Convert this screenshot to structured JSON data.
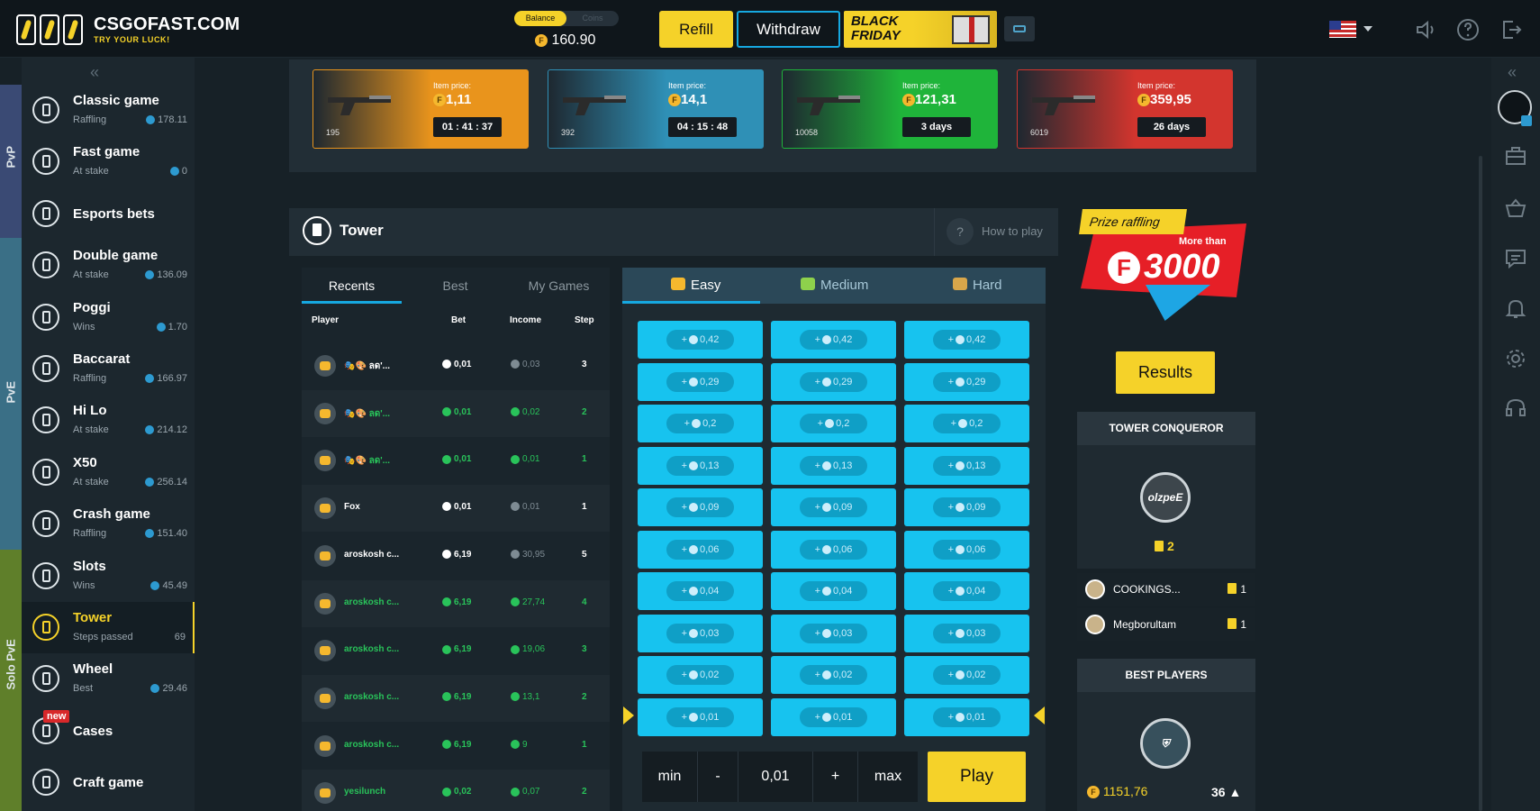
{
  "topbar": {
    "logo_title": "CSGOFAST.COM",
    "logo_subtitle": "TRY YOUR LUCK!",
    "balance_toggle_active": "Balance",
    "balance_toggle_inactive": "Coins",
    "balance_value": "160.90",
    "refill_label": "Refill",
    "withdraw_label": "Withdraw",
    "promo_line1": "BLACK",
    "promo_line2": "FRIDAY",
    "icons": [
      "flag-us-icon",
      "sound-icon",
      "help-icon",
      "logout-icon"
    ]
  },
  "side_tabs": [
    "PvP",
    "PvE",
    "Solo PvE"
  ],
  "sidebar": {
    "items": [
      {
        "name": "Classic game",
        "sub": "Raffling",
        "value": "178.11"
      },
      {
        "name": "Fast game",
        "sub": "At stake",
        "value": "0"
      },
      {
        "name": "Esports bets",
        "sub": "",
        "value": ""
      },
      {
        "name": "Double game",
        "sub": "At stake",
        "value": "136.09"
      },
      {
        "name": "Poggi",
        "sub": "Wins",
        "value": "1.70"
      },
      {
        "name": "Baccarat",
        "sub": "Raffling",
        "value": "166.97"
      },
      {
        "name": "Hi Lo",
        "sub": "At stake",
        "value": "214.12"
      },
      {
        "name": "X50",
        "sub": "At stake",
        "value": "256.14"
      },
      {
        "name": "Crash game",
        "sub": "Raffling",
        "value": "151.40"
      },
      {
        "name": "Slots",
        "sub": "Wins",
        "value": "45.49"
      },
      {
        "name": "Tower",
        "sub": "Steps passed",
        "value": "69"
      },
      {
        "name": "Wheel",
        "sub": "Best",
        "value": "29.46"
      },
      {
        "name": "Cases",
        "sub": "",
        "value": "",
        "badge": "new"
      },
      {
        "name": "Craft game",
        "sub": "",
        "value": ""
      }
    ]
  },
  "banners": [
    {
      "price_label": "Item price:",
      "price": "1,11",
      "timer": "01 : 41 : 37",
      "count": "195",
      "color": "#e9941c"
    },
    {
      "price_label": "Item price:",
      "price": "14,1",
      "timer": "04 : 15 : 48",
      "count": "392",
      "color": "#2f90b6"
    },
    {
      "price_label": "Item price:",
      "price": "121,31",
      "timer": "3 days",
      "count": "10058",
      "color": "#1fb43a"
    },
    {
      "price_label": "Item price:",
      "price": "359,95",
      "timer": "26 days",
      "count": "6019",
      "color": "#d3352e"
    }
  ],
  "tower": {
    "title": "Tower",
    "how_to_play": "How to play",
    "list_tabs": [
      "Recents",
      "Best",
      "My Games"
    ],
    "columns": [
      "Player",
      "Bet",
      "Income",
      "Step"
    ],
    "rows": [
      {
        "player": "🎭🎨 ลด'...",
        "bet": "0,01",
        "income": "0,03",
        "step": "3",
        "win": false
      },
      {
        "player": "🎭🎨 ลด'...",
        "bet": "0,01",
        "income": "0,02",
        "step": "2",
        "win": true
      },
      {
        "player": "🎭🎨 ลด'...",
        "bet": "0,01",
        "income": "0,01",
        "step": "1",
        "win": true
      },
      {
        "player": "Fox",
        "bet": "0,01",
        "income": "0,01",
        "step": "1",
        "win": false
      },
      {
        "player": "aroskosh c...",
        "bet": "6,19",
        "income": "30,95",
        "step": "5",
        "win": false
      },
      {
        "player": "aroskosh c...",
        "bet": "6,19",
        "income": "27,74",
        "step": "4",
        "win": true
      },
      {
        "player": "aroskosh c...",
        "bet": "6,19",
        "income": "19,06",
        "step": "3",
        "win": true
      },
      {
        "player": "aroskosh c...",
        "bet": "6,19",
        "income": "13,1",
        "step": "2",
        "win": true
      },
      {
        "player": "aroskosh c...",
        "bet": "6,19",
        "income": "9",
        "step": "1",
        "win": true
      },
      {
        "player": "yesilunch",
        "bet": "0,02",
        "income": "0,07",
        "step": "2",
        "win": true
      }
    ],
    "difficulty_tabs": [
      "Easy",
      "Medium",
      "Hard"
    ],
    "board_rows": [
      "0,42",
      "0,29",
      "0,2",
      "0,13",
      "0,09",
      "0,06",
      "0,04",
      "0,03",
      "0,02",
      "0,01"
    ],
    "controls": {
      "min": "min",
      "minus": "-",
      "value": "0,01",
      "plus": "+",
      "max": "max",
      "play": "Play"
    }
  },
  "prize": {
    "tag": "Prize raffling",
    "more_than": "More than",
    "amount": "3000",
    "results_label": "Results"
  },
  "conqueror": {
    "title": "TOWER CONQUEROR",
    "top_name": "olzpeE",
    "top_count": "2",
    "list": [
      {
        "name": "COOKINGS...",
        "count": "1"
      },
      {
        "name": "Megborultam",
        "count": "1"
      }
    ]
  },
  "best_players": {
    "title": "BEST PLAYERS",
    "amount": "1151,76",
    "count": "36"
  }
}
